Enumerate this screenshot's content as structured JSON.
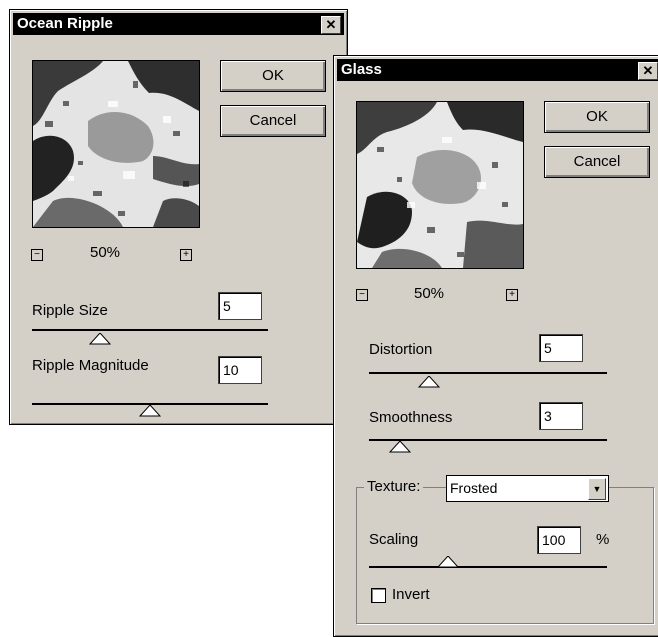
{
  "ocean": {
    "title": "Ocean Ripple",
    "close": "✕",
    "ok": "OK",
    "cancel": "Cancel",
    "zoom_minus": "−",
    "zoom_plus": "+",
    "zoom": "50%",
    "ripple_size_label": "Ripple Size",
    "ripple_size_value": "5",
    "ripple_size_slider": 0.29,
    "ripple_magnitude_label": "Ripple Magnitude",
    "ripple_magnitude_value": "10",
    "ripple_magnitude_slider": 0.5
  },
  "glass": {
    "title": "Glass",
    "close": "✕",
    "ok": "OK",
    "cancel": "Cancel",
    "zoom_minus": "−",
    "zoom_plus": "+",
    "zoom": "50%",
    "distortion_label": "Distortion",
    "distortion_value": "5",
    "distortion_slider": 0.25,
    "smoothness_label": "Smoothness",
    "smoothness_value": "3",
    "smoothness_slider": 0.13,
    "texture_label": "Texture:",
    "texture_value": "Frosted",
    "scaling_label": "Scaling",
    "scaling_value": "100",
    "scaling_unit": "%",
    "scaling_slider": 0.33,
    "invert_label": "Invert",
    "invert_checked": false
  }
}
